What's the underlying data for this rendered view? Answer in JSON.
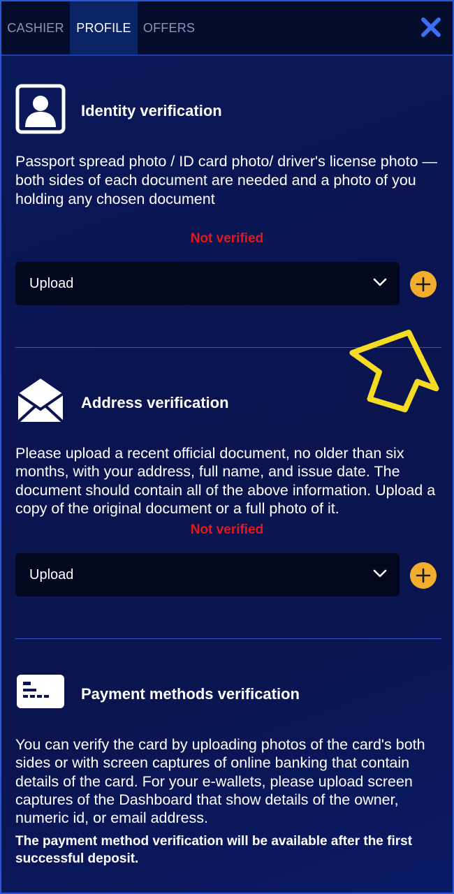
{
  "tabs": [
    {
      "label": "CASHIER",
      "active": false
    },
    {
      "label": "PROFILE",
      "active": true
    },
    {
      "label": "OFFERS",
      "active": false
    }
  ],
  "close_icon": "close-x-icon",
  "identity": {
    "title": "Identity verification",
    "icon": "person-portrait-icon",
    "description": "Passport spread photo / ID card photo/ driver's license photo — both sides of each document are needed and a photo of you holding any chosen document",
    "status": "Not verified",
    "select_value": "Upload"
  },
  "address": {
    "title": "Address verification",
    "icon": "envelope-icon",
    "description": "Please upload a recent official document, no older than six months, with your address, full name, and issue date. The document should contain all of the above information. Upload a copy of the original document or a full photo of it.",
    "status": "Not verified",
    "select_value": "Upload"
  },
  "payment": {
    "title": "Payment methods verification",
    "icon": "card-icon",
    "description": "You can verify the card by uploading photos of the card's both sides or with screen captures of online banking that contain details of the card. For your e-wallets, please upload screen captures of the Dashboard that show details of the owner, numeric id, or email address.",
    "note": "The payment method verification will be available after the first successful deposit."
  },
  "colors": {
    "accent_plus": "#f2ad2c",
    "status_red": "#e11a1a",
    "arrow_yellow": "#f5dc22"
  }
}
